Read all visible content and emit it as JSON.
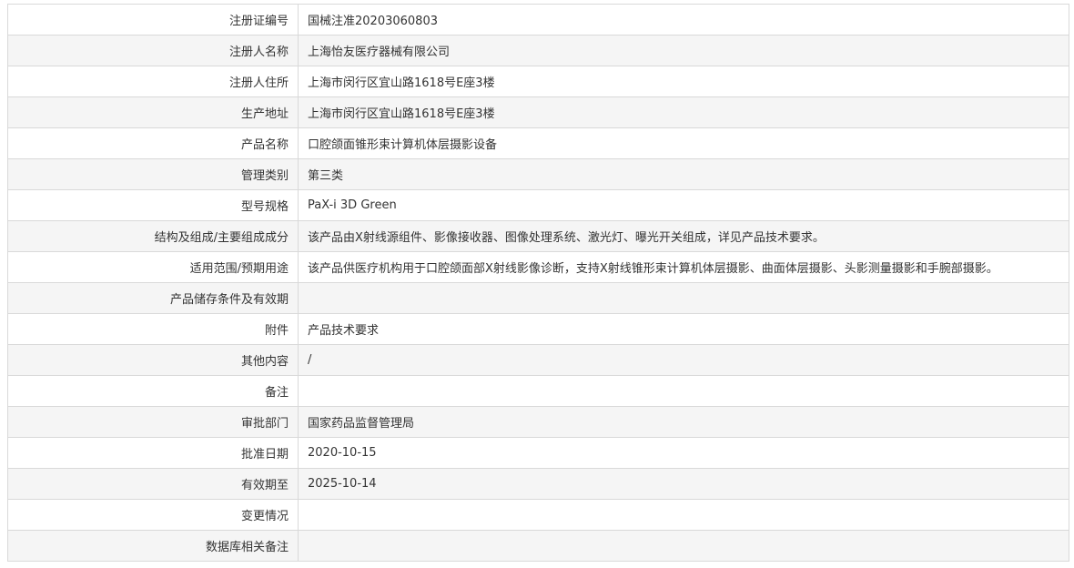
{
  "record": {
    "rows": [
      {
        "label": "注册证编号",
        "value": "国械注准20203060803"
      },
      {
        "label": "注册人名称",
        "value": "上海怡友医疗器械有限公司"
      },
      {
        "label": "注册人住所",
        "value": "上海市闵行区宜山路1618号E座3楼"
      },
      {
        "label": "生产地址",
        "value": "上海市闵行区宜山路1618号E座3楼"
      },
      {
        "label": "产品名称",
        "value": "口腔颌面锥形束计算机体层摄影设备"
      },
      {
        "label": "管理类别",
        "value": "第三类"
      },
      {
        "label": "型号规格",
        "value": "PaX-i 3D Green"
      },
      {
        "label": "结构及组成/主要组成成分",
        "value": "该产品由X射线源组件、影像接收器、图像处理系统、激光灯、曝光开关组成，详见产品技术要求。"
      },
      {
        "label": "适用范围/预期用途",
        "value": "该产品供医疗机构用于口腔颌面部X射线影像诊断，支持X射线锥形束计算机体层摄影、曲面体层摄影、头影测量摄影和手腕部摄影。"
      },
      {
        "label": "产品储存条件及有效期",
        "value": ""
      },
      {
        "label": "附件",
        "value": "产品技术要求"
      },
      {
        "label": "其他内容",
        "value": "/"
      },
      {
        "label": "备注",
        "value": ""
      },
      {
        "label": "审批部门",
        "value": "国家药品监督管理局"
      },
      {
        "label": "批准日期",
        "value": "2020-10-15"
      },
      {
        "label": "有效期至",
        "value": "2025-10-14"
      },
      {
        "label": "变更情况",
        "value": ""
      },
      {
        "label": "数据库相关备注",
        "value": ""
      }
    ]
  },
  "colors": {
    "border": "#d9d9d9",
    "stripe": "#f5f5f5",
    "text": "#333333"
  }
}
